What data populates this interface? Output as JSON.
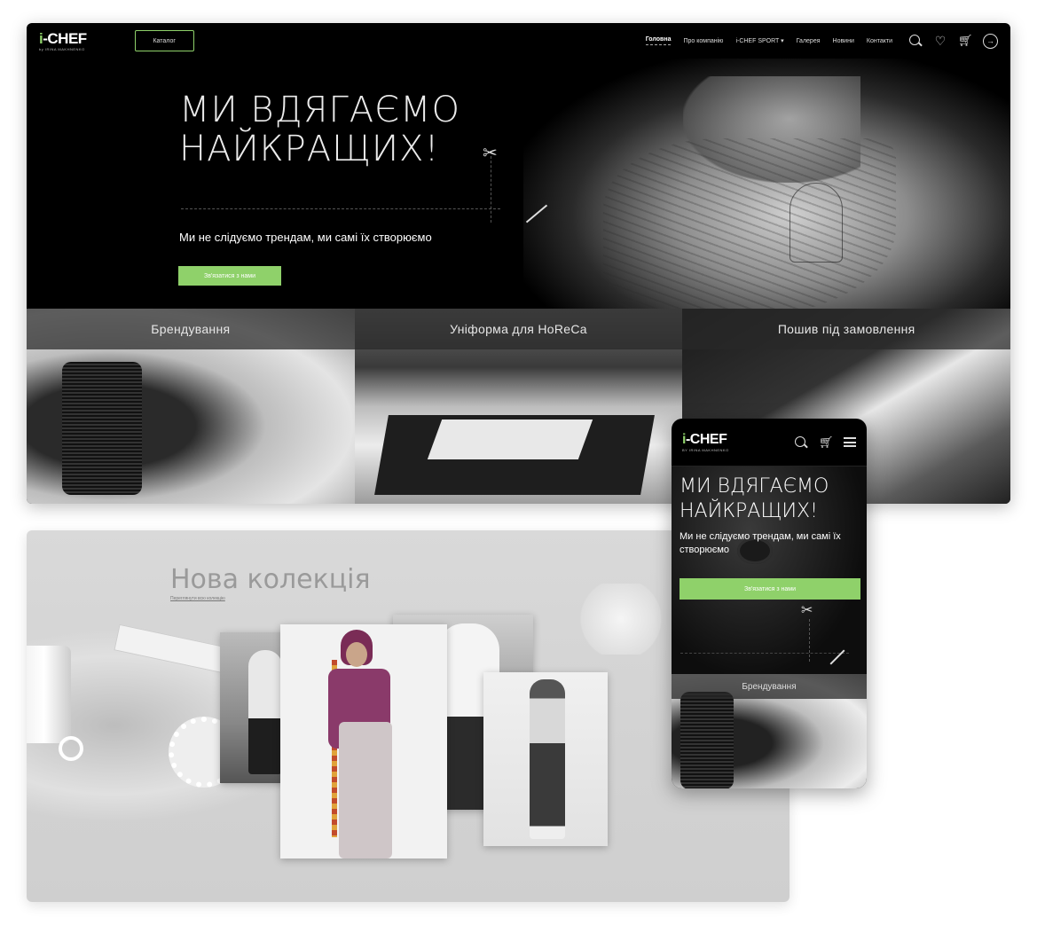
{
  "desktop": {
    "logo": {
      "mark_i": "i",
      "mark_rest": "-CHEF",
      "tagline": "by IRINA MAKHNENKO"
    },
    "catalog_label": "Каталог",
    "nav": [
      {
        "label": "Головна",
        "active": true
      },
      {
        "label": "Про компанію",
        "active": false
      },
      {
        "label": "i-CHEF SPORT ▾",
        "active": false
      },
      {
        "label": "Галерея",
        "active": false
      },
      {
        "label": "Новини",
        "active": false
      },
      {
        "label": "Контакти",
        "active": false
      }
    ],
    "icons": [
      "search-icon",
      "heart-icon",
      "cart-icon",
      "login-icon"
    ],
    "hero": {
      "title_line1": "МИ ВДЯГАЄМО",
      "title_line2": "НАЙКРАЩИХ!",
      "subtitle": "Ми не слідуємо трендам, ми самі їх створюємо",
      "cta": "Зв'язатися з нами"
    },
    "categories": [
      "Брендування",
      "Уніформа для HoReCa",
      "Пошив під замовлення"
    ]
  },
  "collection": {
    "title": "Нова колекція",
    "link": "Переглянути всю колекцію"
  },
  "mobile": {
    "logo": {
      "mark_i": "i",
      "mark_rest": "-CHEF",
      "tagline": "BY IRINA MAKHNENKO"
    },
    "title_line1": "МИ ВДЯГАЄМО",
    "title_line2": "НАЙКРАЩИХ!",
    "subtitle": "Ми не слідуємо трендам, ми самі їх створюємо",
    "cta": "Зв'язатися з нами",
    "category": "Брендування"
  },
  "colors": {
    "accent": "#8fd16a",
    "dark": "#000000"
  }
}
